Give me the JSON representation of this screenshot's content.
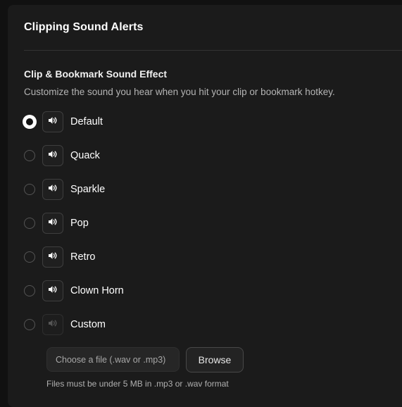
{
  "header": {
    "title": "Clipping Sound Alerts"
  },
  "section": {
    "title": "Clip & Bookmark Sound Effect",
    "description": "Customize the sound you hear when you hit your clip or bookmark hotkey."
  },
  "options": [
    {
      "label": "Default",
      "selected": true,
      "play_icon": "speaker-icon"
    },
    {
      "label": "Quack",
      "selected": false,
      "play_icon": "speaker-icon"
    },
    {
      "label": "Sparkle",
      "selected": false,
      "play_icon": "speaker-icon"
    },
    {
      "label": "Pop",
      "selected": false,
      "play_icon": "speaker-icon"
    },
    {
      "label": "Retro",
      "selected": false,
      "play_icon": "speaker-icon"
    },
    {
      "label": "Clown Horn",
      "selected": false,
      "play_icon": "speaker-icon"
    },
    {
      "label": "Custom",
      "selected": false,
      "play_icon": "speaker-icon",
      "disabled": true
    }
  ],
  "custom_file": {
    "placeholder": "Choose a file (.wav or .mp3)",
    "browse_label": "Browse",
    "help_text": "Files must be under 5 MB in .mp3 or .wav format"
  },
  "colors": {
    "background": "#111111",
    "panel": "#1b1b1b",
    "selected_radio": "#ffffff",
    "muted_text": "#b4b4b4"
  }
}
